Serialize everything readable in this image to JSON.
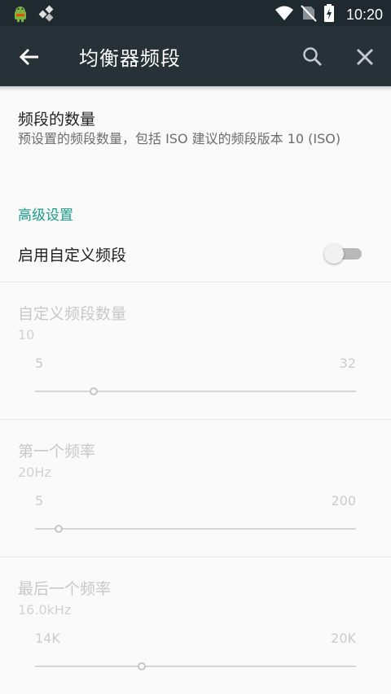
{
  "status_bar": {
    "time": "10:20",
    "icons": [
      "android-debug-icon",
      "app-notification-icon",
      "wifi-icon",
      "no-sim-icon",
      "battery-charging-icon"
    ]
  },
  "toolbar": {
    "title": "均衡器频段",
    "back_icon": "arrow-left-icon",
    "search_icon": "search-icon",
    "close_icon": "close-icon"
  },
  "band_count": {
    "title": "频段的数量",
    "summary": "预设置的频段数量，包括 ISO 建议的频段版本 10 (ISO)"
  },
  "advanced": {
    "category_label": "高级设置",
    "custom_bands": {
      "title": "启用自定义频段",
      "enabled": false
    }
  },
  "custom_band_count": {
    "title": "自定义频段数量",
    "value": "10",
    "min_label": "5",
    "max_label": "32",
    "slider_value": 10
  },
  "first_frequency": {
    "title": "第一个频率",
    "value": "20Hz",
    "min_label": "5",
    "max_label": "200",
    "slider_value": 20
  },
  "last_frequency": {
    "title": "最后一个频率",
    "value": "16.0kHz",
    "min_label": "14K",
    "max_label": "20K",
    "slider_value": 16
  },
  "colors": {
    "toolbar": "#263238",
    "statusbar": "#1f2a30",
    "accent": "#1b9c8a"
  }
}
